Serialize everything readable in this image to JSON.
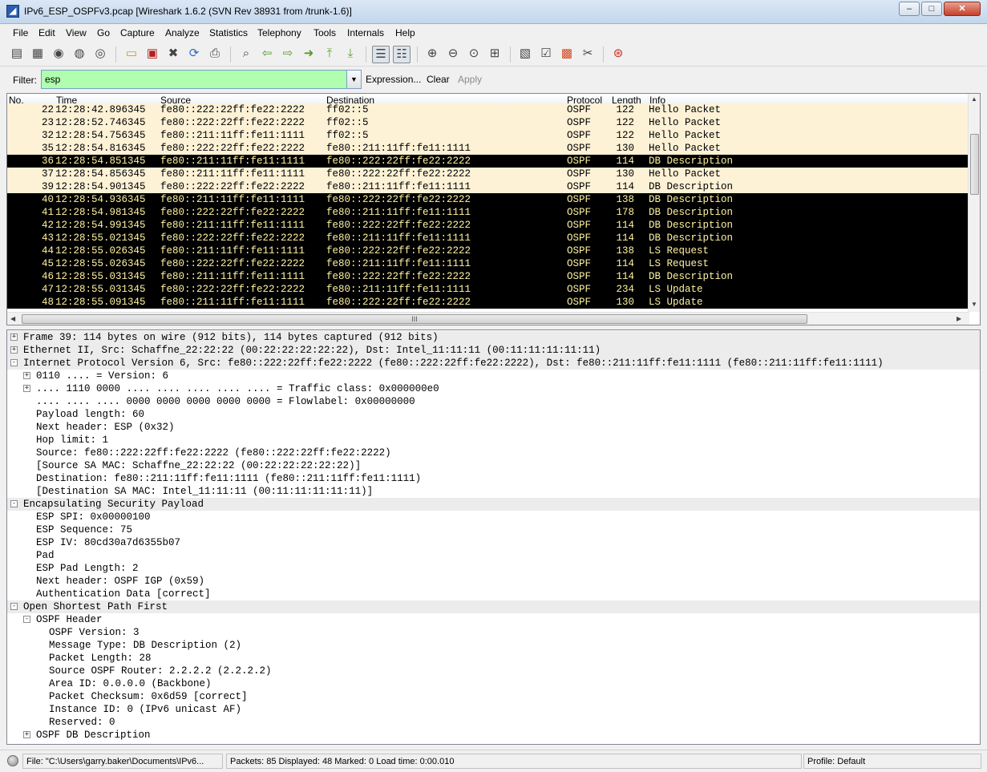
{
  "window": {
    "title": "IPv6_ESP_OSPFv3.pcap  [Wireshark 1.6.2  (SVN Rev 38931 from /trunk-1.6)]",
    "min": "–",
    "max": "□",
    "close": "✕"
  },
  "menu": [
    "File",
    "Edit",
    "View",
    "Go",
    "Capture",
    "Analyze",
    "Statistics",
    "Telephony",
    "Tools",
    "Internals",
    "Help"
  ],
  "toolbar": {
    "icons": [
      "interface-list-icon",
      "capture-options-icon",
      "start-capture-icon",
      "stop-capture-icon",
      "restart-capture-icon",
      "open-file-icon",
      "save-file-icon",
      "close-file-icon",
      "reload-icon",
      "print-icon",
      "find-packet-icon",
      "go-back-icon",
      "go-forward-icon",
      "go-to-packet-icon",
      "go-first-icon",
      "go-last-icon",
      "colorize-icon",
      "auto-scroll-icon",
      "zoom-in-icon",
      "zoom-out-icon",
      "normal-size-icon",
      "resize-columns-icon",
      "capture-filters-icon",
      "display-filters-icon",
      "coloring-rules-icon",
      "preferences-icon",
      "help-icon"
    ]
  },
  "filter": {
    "label": "Filter:",
    "value": "esp",
    "expression": "Expression...",
    "clear": "Clear",
    "apply": "Apply"
  },
  "packet_list": {
    "headers": {
      "no": "No.",
      "time": "Time",
      "source": "Source",
      "destination": "Destination",
      "protocol": "Protocol",
      "length": "Length",
      "info": "Info"
    },
    "rows": [
      {
        "no": "22",
        "time": "12:28:42.896345",
        "src": "fe80::222:22ff:fe22:2222",
        "dst": "ff02::5",
        "proto": "OSPF",
        "len": "122",
        "info": "Hello Packet",
        "style": "hello2"
      },
      {
        "no": "23",
        "time": "12:28:52.746345",
        "src": "fe80::222:22ff:fe22:2222",
        "dst": "ff02::5",
        "proto": "OSPF",
        "len": "122",
        "info": "Hello Packet",
        "style": "hello2"
      },
      {
        "no": "32",
        "time": "12:28:54.756345",
        "src": "fe80::211:11ff:fe11:1111",
        "dst": "ff02::5",
        "proto": "OSPF",
        "len": "122",
        "info": "Hello Packet",
        "style": "hello2"
      },
      {
        "no": "35",
        "time": "12:28:54.816345",
        "src": "fe80::222:22ff:fe22:2222",
        "dst": "fe80::211:11ff:fe11:1111",
        "proto": "OSPF",
        "len": "130",
        "info": "Hello Packet",
        "style": "hello2"
      },
      {
        "no": "36",
        "time": "12:28:54.851345",
        "src": "fe80::211:11ff:fe11:1111",
        "dst": "fe80::222:22ff:fe22:2222",
        "proto": "OSPF",
        "len": "114",
        "info": "DB Description",
        "style": "black"
      },
      {
        "no": "37",
        "time": "12:28:54.856345",
        "src": "fe80::211:11ff:fe11:1111",
        "dst": "fe80::222:22ff:fe22:2222",
        "proto": "OSPF",
        "len": "130",
        "info": "Hello Packet",
        "style": "hello2"
      },
      {
        "no": "39",
        "time": "12:28:54.901345",
        "src": "fe80::222:22ff:fe22:2222",
        "dst": "fe80::211:11ff:fe11:1111",
        "proto": "OSPF",
        "len": "114",
        "info": "DB Description",
        "style": "white"
      },
      {
        "no": "40",
        "time": "12:28:54.936345",
        "src": "fe80::211:11ff:fe11:1111",
        "dst": "fe80::222:22ff:fe22:2222",
        "proto": "OSPF",
        "len": "138",
        "info": "DB Description",
        "style": "black"
      },
      {
        "no": "41",
        "time": "12:28:54.981345",
        "src": "fe80::222:22ff:fe22:2222",
        "dst": "fe80::211:11ff:fe11:1111",
        "proto": "OSPF",
        "len": "178",
        "info": "DB Description",
        "style": "black"
      },
      {
        "no": "42",
        "time": "12:28:54.991345",
        "src": "fe80::211:11ff:fe11:1111",
        "dst": "fe80::222:22ff:fe22:2222",
        "proto": "OSPF",
        "len": "114",
        "info": "DB Description",
        "style": "black"
      },
      {
        "no": "43",
        "time": "12:28:55.021345",
        "src": "fe80::222:22ff:fe22:2222",
        "dst": "fe80::211:11ff:fe11:1111",
        "proto": "OSPF",
        "len": "114",
        "info": "DB Description",
        "style": "black"
      },
      {
        "no": "44",
        "time": "12:28:55.026345",
        "src": "fe80::211:11ff:fe11:1111",
        "dst": "fe80::222:22ff:fe22:2222",
        "proto": "OSPF",
        "len": "138",
        "info": "LS Request",
        "style": "black"
      },
      {
        "no": "45",
        "time": "12:28:55.026345",
        "src": "fe80::222:22ff:fe22:2222",
        "dst": "fe80::211:11ff:fe11:1111",
        "proto": "OSPF",
        "len": "114",
        "info": "LS Request",
        "style": "black"
      },
      {
        "no": "46",
        "time": "12:28:55.031345",
        "src": "fe80::211:11ff:fe11:1111",
        "dst": "fe80::222:22ff:fe22:2222",
        "proto": "OSPF",
        "len": "114",
        "info": "DB Description",
        "style": "black"
      },
      {
        "no": "47",
        "time": "12:28:55.031345",
        "src": "fe80::222:22ff:fe22:2222",
        "dst": "fe80::211:11ff:fe11:1111",
        "proto": "OSPF",
        "len": "234",
        "info": "LS Update",
        "style": "black"
      },
      {
        "no": "48",
        "time": "12:28:55.091345",
        "src": "fe80::211:11ff:fe11:1111",
        "dst": "fe80::222:22ff:fe22:2222",
        "proto": "OSPF",
        "len": "130",
        "info": "LS Update",
        "style": "black"
      }
    ],
    "scroll_grip": "III"
  },
  "details": [
    {
      "level": 0,
      "exp": "+",
      "top": true,
      "text": "Frame 39: 114 bytes on wire (912 bits), 114 bytes captured (912 bits)"
    },
    {
      "level": 0,
      "exp": "+",
      "top": true,
      "text": "Ethernet II, Src: Schaffne_22:22:22 (00:22:22:22:22:22), Dst: Intel_11:11:11 (00:11:11:11:11:11)"
    },
    {
      "level": 0,
      "exp": "-",
      "top": true,
      "text": "Internet Protocol Version 6, Src: fe80::222:22ff:fe22:2222 (fe80::222:22ff:fe22:2222), Dst: fe80::211:11ff:fe11:1111 (fe80::211:11ff:fe11:1111)"
    },
    {
      "level": 1,
      "exp": "+",
      "text": "0110 .... = Version: 6"
    },
    {
      "level": 1,
      "exp": "+",
      "text": ".... 1110 0000 .... .... .... .... .... = Traffic class: 0x000000e0"
    },
    {
      "level": 1,
      "exp": "",
      "text": ".... .... .... 0000 0000 0000 0000 0000 = Flowlabel: 0x00000000"
    },
    {
      "level": 1,
      "exp": "",
      "text": "Payload length: 60"
    },
    {
      "level": 1,
      "exp": "",
      "text": "Next header: ESP (0x32)"
    },
    {
      "level": 1,
      "exp": "",
      "text": "Hop limit: 1"
    },
    {
      "level": 1,
      "exp": "",
      "text": "Source: fe80::222:22ff:fe22:2222 (fe80::222:22ff:fe22:2222)"
    },
    {
      "level": 1,
      "exp": "",
      "text": "[Source SA MAC: Schaffne_22:22:22 (00:22:22:22:22:22)]"
    },
    {
      "level": 1,
      "exp": "",
      "text": "Destination: fe80::211:11ff:fe11:1111 (fe80::211:11ff:fe11:1111)"
    },
    {
      "level": 1,
      "exp": "",
      "text": "[Destination SA MAC: Intel_11:11:11 (00:11:11:11:11:11)]"
    },
    {
      "level": 0,
      "exp": "-",
      "top": true,
      "text": "Encapsulating Security Payload"
    },
    {
      "level": 1,
      "exp": "",
      "text": "ESP SPI: 0x00000100"
    },
    {
      "level": 1,
      "exp": "",
      "text": "ESP Sequence: 75"
    },
    {
      "level": 1,
      "exp": "",
      "text": "ESP IV: 80cd30a7d6355b07"
    },
    {
      "level": 1,
      "exp": "",
      "text": "Pad"
    },
    {
      "level": 1,
      "exp": "",
      "text": "ESP Pad Length: 2"
    },
    {
      "level": 1,
      "exp": "",
      "text": "Next header: OSPF IGP (0x59)"
    },
    {
      "level": 1,
      "exp": "",
      "text": "Authentication Data [correct]"
    },
    {
      "level": 0,
      "exp": "-",
      "top": true,
      "text": "Open Shortest Path First"
    },
    {
      "level": 1,
      "exp": "-",
      "text": "OSPF Header"
    },
    {
      "level": 2,
      "exp": "",
      "text": "OSPF Version: 3"
    },
    {
      "level": 2,
      "exp": "",
      "text": "Message Type: DB Description (2)"
    },
    {
      "level": 2,
      "exp": "",
      "text": "Packet Length: 28"
    },
    {
      "level": 2,
      "exp": "",
      "text": "Source OSPF Router: 2.2.2.2 (2.2.2.2)"
    },
    {
      "level": 2,
      "exp": "",
      "text": "Area ID: 0.0.0.0 (Backbone)"
    },
    {
      "level": 2,
      "exp": "",
      "text": "Packet Checksum: 0x6d59 [correct]"
    },
    {
      "level": 2,
      "exp": "",
      "text": "Instance ID: 0 (IPv6 unicast AF)"
    },
    {
      "level": 2,
      "exp": "",
      "text": "Reserved: 0"
    },
    {
      "level": 1,
      "exp": "+",
      "text": "OSPF DB Description"
    }
  ],
  "status": {
    "file": "File: \"C:\\Users\\garry.baker\\Documents\\IPv6...",
    "packets": "Packets: 85 Displayed: 48 Marked: 0 Load time: 0:00.010",
    "profile": "Profile: Default"
  }
}
